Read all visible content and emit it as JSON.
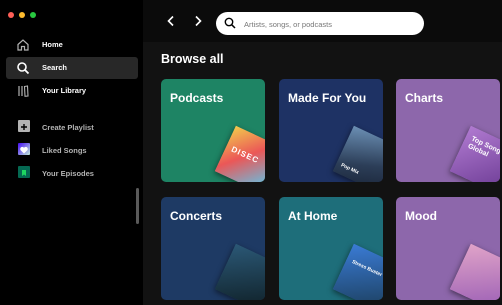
{
  "window": {
    "controls": [
      "close",
      "minimize",
      "maximize"
    ]
  },
  "sidebar": {
    "items": [
      {
        "label": "Home",
        "icon": "home-icon"
      },
      {
        "label": "Search",
        "icon": "search-icon"
      },
      {
        "label": "Your Library",
        "icon": "library-icon"
      }
    ],
    "playlist_actions": [
      {
        "label": "Create Playlist",
        "icon": "plus-icon"
      },
      {
        "label": "Liked Songs",
        "icon": "heart-icon"
      },
      {
        "label": "Your Episodes",
        "icon": "episodes-icon"
      }
    ]
  },
  "search": {
    "placeholder": "Artists, songs, or podcasts"
  },
  "main": {
    "heading": "Browse all",
    "cards": [
      {
        "title": "Podcasts",
        "color": "#1e8464",
        "art_text": "DISEC"
      },
      {
        "title": "Made For You",
        "color": "#1e3264",
        "art_text": "Pop Mix"
      },
      {
        "title": "Charts",
        "color": "#8d67ab",
        "art_text": "Top Songs Global"
      },
      {
        "title": "Concerts",
        "color": "#1e3a64",
        "art_text": ""
      },
      {
        "title": "At Home",
        "color": "#1e6e7a",
        "art_text": "Stress Buster"
      },
      {
        "title": "Mood",
        "color": "#8d67ab",
        "art_text": ""
      }
    ]
  },
  "colors": {
    "accent": "#1db954",
    "close": "#ff5f57",
    "minimize": "#febc2e",
    "maximize": "#28c840"
  }
}
